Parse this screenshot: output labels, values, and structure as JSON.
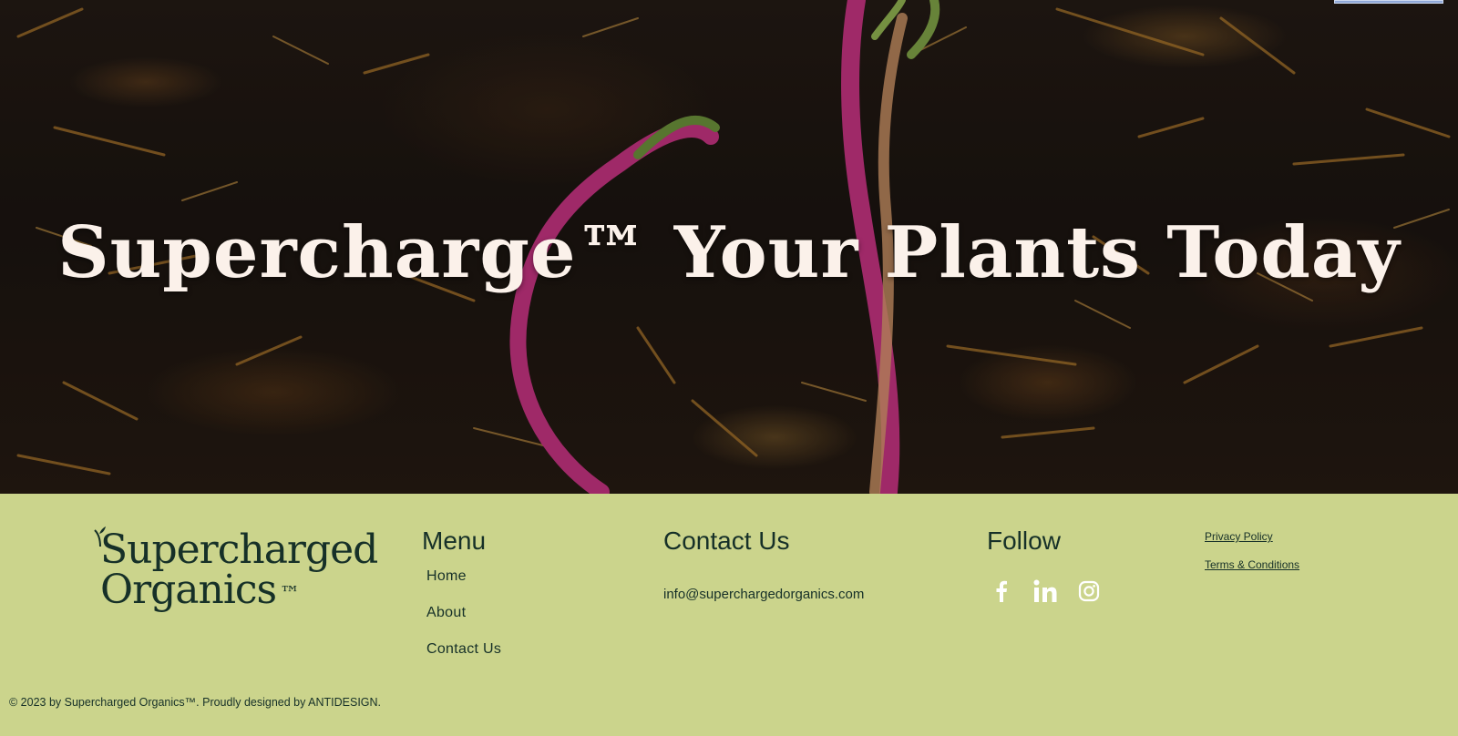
{
  "hero": {
    "title": "Supercharge™ Your Plants Today"
  },
  "footer": {
    "logo": {
      "line1": "Supercharged",
      "line2": "Organics",
      "tm": "™"
    },
    "menu": {
      "heading": "Menu",
      "items": [
        "Home",
        "About",
        "Contact Us"
      ]
    },
    "contact": {
      "heading": "Contact Us",
      "email": "info@superchargedorganics.com"
    },
    "follow": {
      "heading": "Follow",
      "icons": [
        "facebook-icon",
        "linkedin-icon",
        "instagram-icon"
      ]
    },
    "legal": {
      "privacy": "Privacy Policy",
      "terms": "Terms & Conditions"
    },
    "copyright": "© 2023 by Supercharged Organics™. Proudly designed by ANTIDESIGN."
  },
  "colors": {
    "footer_bg": "#cbd48c",
    "text_dark": "#163028",
    "hero_title": "#fbf1ea"
  }
}
